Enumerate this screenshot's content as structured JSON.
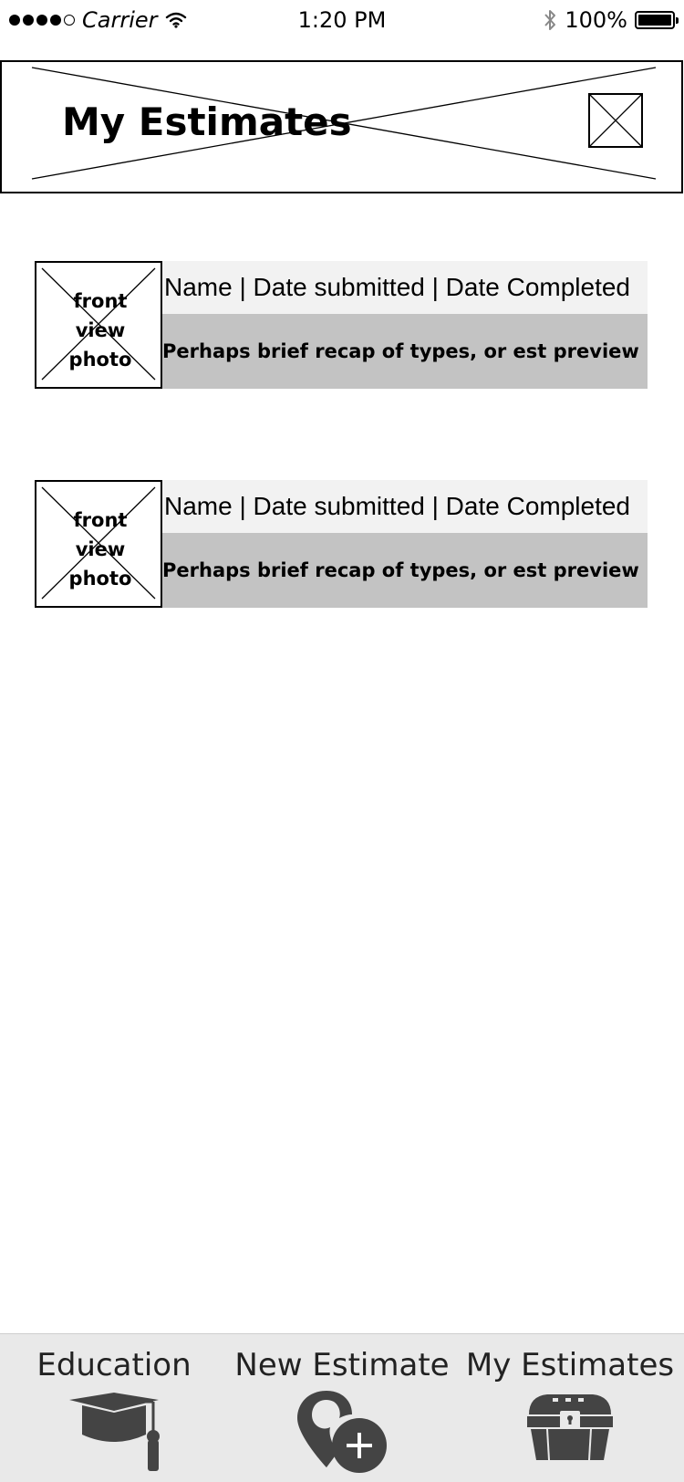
{
  "status_bar": {
    "carrier": "Carrier",
    "time": "1:20 PM",
    "battery": "100%",
    "battery_level": 1.0,
    "signal_bars_filled": 4,
    "signal_bars_total": 5,
    "icons": [
      "wifi-icon",
      "bluetooth-icon",
      "battery-icon"
    ]
  },
  "header": {
    "title": "My Estimates",
    "image_placeholder_icon": "image-placeholder-icon"
  },
  "estimates": [
    {
      "photo_label_lines": [
        "front",
        "view",
        "photo"
      ],
      "title": "Name | Date submitted | Date Completed",
      "preview": "Perhaps brief recap of types, or est preview"
    },
    {
      "photo_label_lines": [
        "front",
        "view",
        "photo"
      ],
      "title": "Name | Date submitted | Date Completed",
      "preview": "Perhaps brief recap of types, or est preview"
    }
  ],
  "tab_bar": {
    "tabs": [
      {
        "label": "Education",
        "icon": "graduation-cap-icon"
      },
      {
        "label": "New Estimate",
        "icon": "location-pin-add-icon"
      },
      {
        "label": "My Estimates",
        "icon": "treasure-chest-icon"
      }
    ]
  },
  "colors": {
    "title_bar_bg": "#f2f2f2",
    "preview_bar_bg": "#c3c3c3",
    "tab_bar_bg": "#e9e9e9",
    "icon_color": "#444444"
  }
}
